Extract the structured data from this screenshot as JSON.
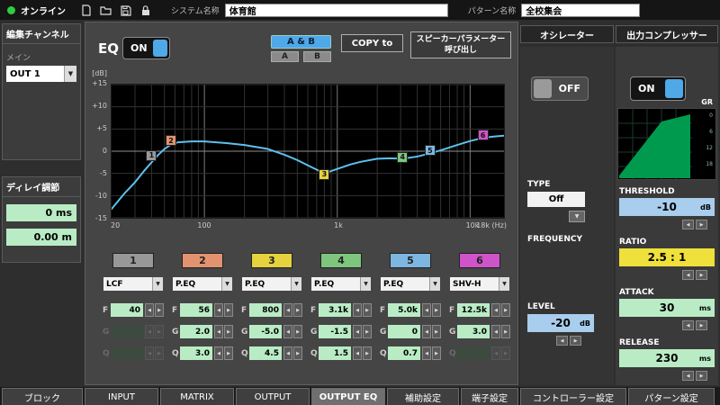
{
  "colors": {
    "accent_blue": "#4fa8e8",
    "field_green": "#b9ecc5",
    "field_blue": "#a9cdec",
    "field_yellow": "#f0e03c",
    "curve_blue": "#5fc0ee",
    "meter_green": "#009a4e",
    "online_green": "#2ecc40"
  },
  "topbar": {
    "online": "オンライン",
    "system_label": "システム名称",
    "system_value": "体育館",
    "pattern_label": "パターン名称",
    "pattern_value": "全校集会"
  },
  "sidebar": {
    "edit_channel_title": "編集チャンネル",
    "main_label": "メイン",
    "out_select": "OUT 1",
    "delay_title": "ディレイ調節",
    "delay_ms": "0 ms",
    "delay_m": "0.00 m"
  },
  "eq": {
    "label": "EQ",
    "on": "ON",
    "ab": "A & B",
    "a": "A",
    "b": "B",
    "copy": "COPY to",
    "recall_line1": "スピーカーパラメーター",
    "recall_line2": "呼び出し",
    "db_unit": "[dB]",
    "yticks": [
      "+15",
      "+10",
      "+5",
      "0",
      "-5",
      "-10",
      "-15"
    ],
    "xticks": [
      "20",
      "100",
      "1k",
      "10k",
      "18k (Hz)"
    ]
  },
  "eq_curve": {
    "points": [
      [
        20,
        -13
      ],
      [
        25,
        -9.5
      ],
      [
        30,
        -7
      ],
      [
        35,
        -4.5
      ],
      [
        40,
        -2.5
      ],
      [
        45,
        -0.8
      ],
      [
        50,
        0.5
      ],
      [
        56,
        1.5
      ],
      [
        63,
        2.0
      ],
      [
        80,
        2.2
      ],
      [
        100,
        2.2
      ],
      [
        150,
        1.8
      ],
      [
        200,
        1.4
      ],
      [
        300,
        0.5
      ],
      [
        400,
        -0.8
      ],
      [
        500,
        -2
      ],
      [
        630,
        -3.5
      ],
      [
        800,
        -5
      ],
      [
        1000,
        -4
      ],
      [
        1250,
        -3
      ],
      [
        1500,
        -2.4
      ],
      [
        2000,
        -1.7
      ],
      [
        2500,
        -1.6
      ],
      [
        3100,
        -1.7
      ],
      [
        4000,
        -1.2
      ],
      [
        5000,
        -0.5
      ],
      [
        6300,
        0.4
      ],
      [
        8000,
        1.4
      ],
      [
        10000,
        2.3
      ],
      [
        12500,
        3
      ],
      [
        15000,
        3.3
      ],
      [
        18000,
        3.5
      ]
    ],
    "markers": [
      {
        "num": "1",
        "freq": 40,
        "db": -1,
        "color": "#989898"
      },
      {
        "num": "2",
        "freq": 56,
        "db": 2.4,
        "color": "#e2926e"
      },
      {
        "num": "3",
        "freq": 800,
        "db": -5.2,
        "color": "#e5d23e"
      },
      {
        "num": "4",
        "freq": 3100,
        "db": -1.4,
        "color": "#7ec67e"
      },
      {
        "num": "5",
        "freq": 5000,
        "db": 0.2,
        "color": "#7db6e0"
      },
      {
        "num": "6",
        "freq": 12500,
        "db": 3.6,
        "color": "#cf54c9"
      }
    ]
  },
  "band_row_labels": {
    "f": "F",
    "g": "G",
    "q": "Q"
  },
  "bands": [
    {
      "num": "1",
      "color": "#989898",
      "type": "LCF",
      "f": "40",
      "g": "",
      "q": ""
    },
    {
      "num": "2",
      "color": "#e2926e",
      "type": "P.EQ",
      "f": "56",
      "g": "2.0",
      "q": "3.0"
    },
    {
      "num": "3",
      "color": "#e5d23e",
      "type": "P.EQ",
      "f": "800",
      "g": "-5.0",
      "q": "4.5"
    },
    {
      "num": "4",
      "color": "#7ec67e",
      "type": "P.EQ",
      "f": "3.1k",
      "g": "-1.5",
      "q": "1.5"
    },
    {
      "num": "5",
      "color": "#7db6e0",
      "type": "P.EQ",
      "f": "5.0k",
      "g": "0",
      "q": "0.7"
    },
    {
      "num": "6",
      "color": "#cf54c9",
      "type": "SHV-H",
      "f": "12.5k",
      "g": "3.0",
      "q": ""
    }
  ],
  "right": {
    "osc_section": "オシレーター",
    "comp_section": "出力コンプレッサー",
    "osc_off": "OFF",
    "comp_on": "ON",
    "gr": "GR",
    "gr_ticks": [
      "0",
      "6",
      "12",
      "18"
    ],
    "type_label": "TYPE",
    "type_value": "Off",
    "freq_label": "FREQUENCY",
    "level_label": "LEVEL",
    "level_value": "-20",
    "level_unit": "dB",
    "threshold_label": "THRESHOLD",
    "threshold_value": "-10",
    "threshold_unit": "dB",
    "ratio_label": "RATIO",
    "ratio_value": "2.5 : 1",
    "attack_label": "ATTACK",
    "attack_value": "30",
    "attack_unit": "ms",
    "release_label": "RELEASE",
    "release_value": "230",
    "release_unit": "ms"
  },
  "tabs": [
    {
      "label": "ブロック"
    },
    {
      "label": "INPUT"
    },
    {
      "label": "MATRIX"
    },
    {
      "label": "OUTPUT"
    },
    {
      "label": "OUTPUT EQ",
      "active": true
    },
    {
      "label": "補助設定"
    },
    {
      "label": "端子設定"
    },
    {
      "label": "コントローラー設定"
    },
    {
      "label": "パターン設定"
    }
  ]
}
